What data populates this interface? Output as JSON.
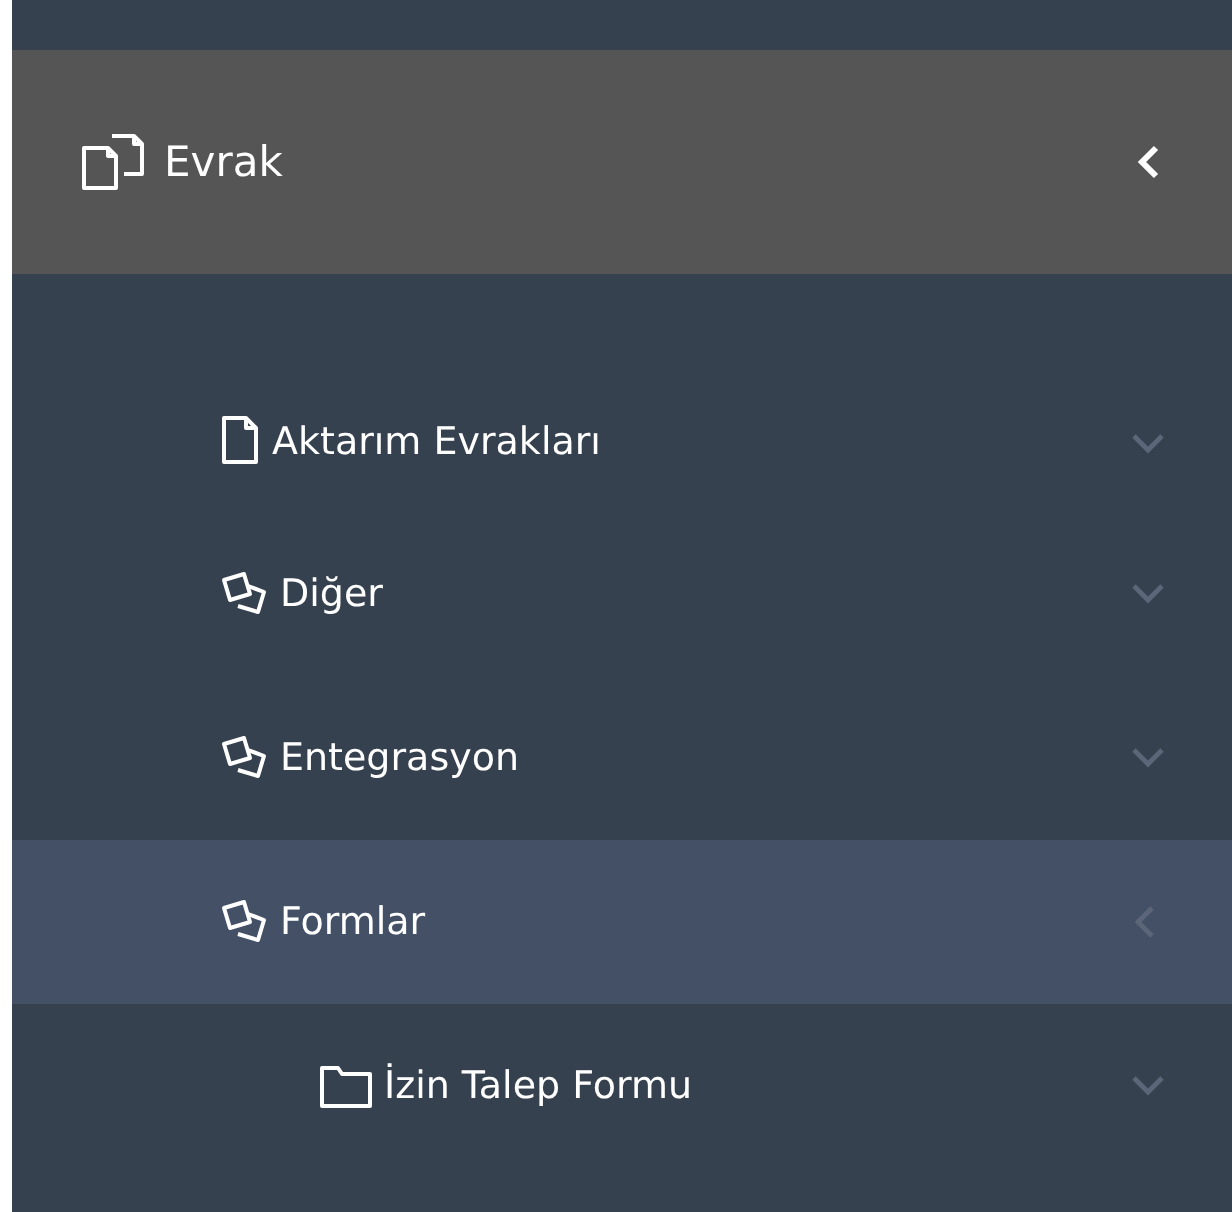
{
  "menu": {
    "label": "Evrak",
    "expanded": true,
    "items": [
      {
        "label": "Aktarım Evrakları",
        "kind": "document",
        "expanded": false,
        "selected": false
      },
      {
        "label": "Diğer",
        "kind": "group",
        "expanded": false,
        "selected": false
      },
      {
        "label": "Entegrasyon",
        "kind": "group",
        "expanded": false,
        "selected": false
      },
      {
        "label": "Formlar",
        "kind": "group",
        "expanded": true,
        "selected": true,
        "children": [
          {
            "label": "İzin Talep Formu",
            "kind": "folder",
            "expanded": false,
            "selected": false
          }
        ]
      }
    ]
  }
}
